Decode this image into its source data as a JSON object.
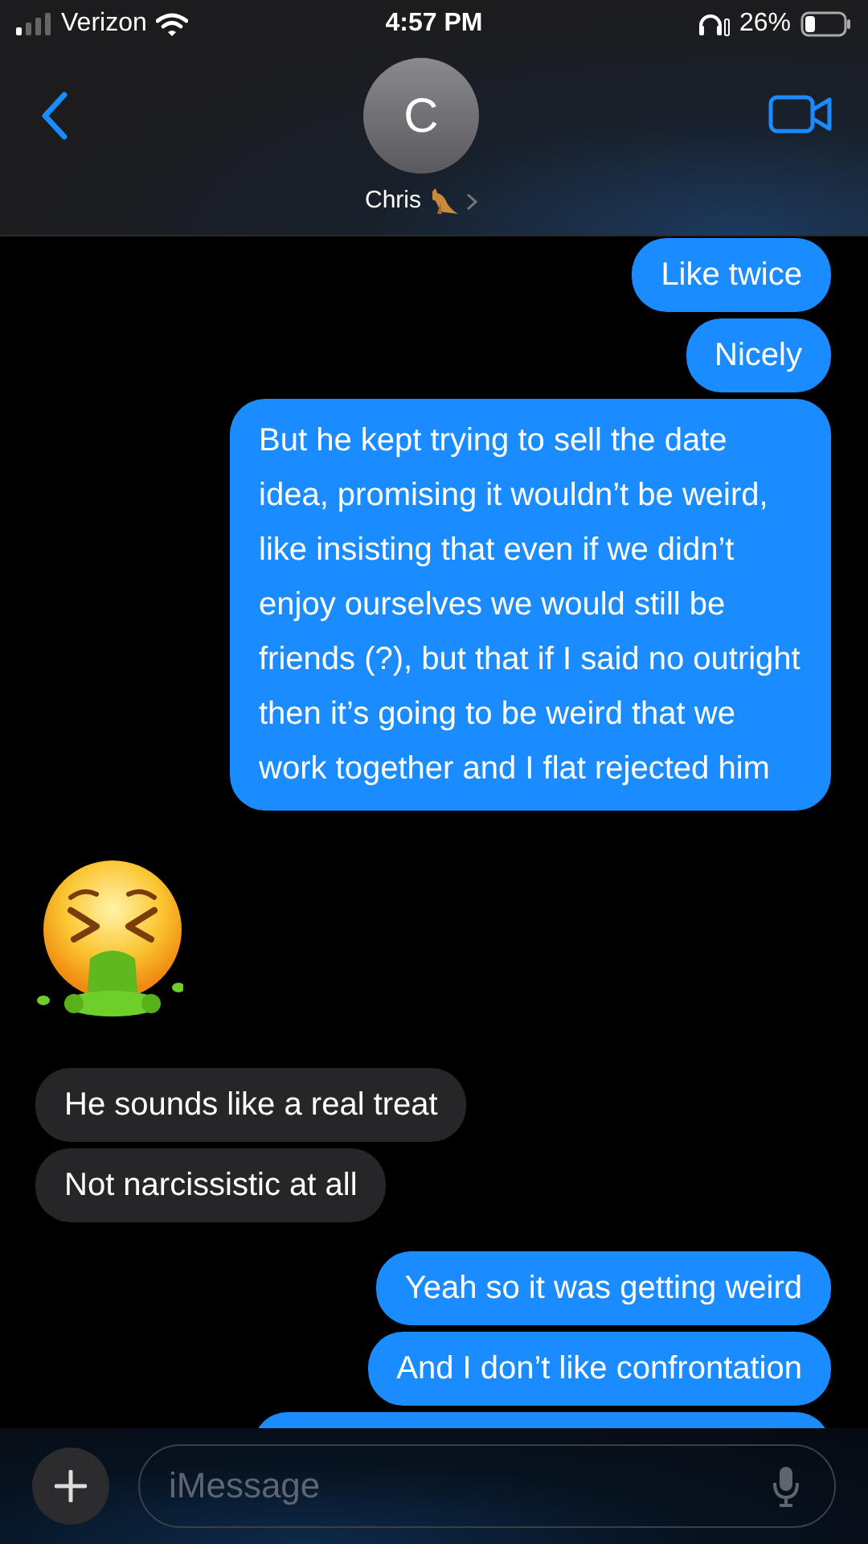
{
  "status_bar": {
    "carrier": "Verizon",
    "time": "4:57 PM",
    "battery": "26%"
  },
  "header": {
    "avatar_initial": "C",
    "contact_name": "Chris"
  },
  "messages": [
    {
      "kind": "text",
      "outgoing": true,
      "text": "Like twice"
    },
    {
      "kind": "text",
      "outgoing": true,
      "text": "Nicely"
    },
    {
      "kind": "text",
      "outgoing": true,
      "text": "But he kept trying to sell the date idea, promising it wouldn’t be weird, like insisting that even if we didn’t enjoy ourselves we would still be friends (?), but that if I said no outright then it’s going to be weird that we work together and I flat rejected him"
    },
    {
      "kind": "emoji",
      "outgoing": false
    },
    {
      "kind": "text",
      "outgoing": false,
      "text": "He sounds like a real treat"
    },
    {
      "kind": "text",
      "outgoing": false,
      "text": "Not narcissistic at all"
    },
    {
      "kind": "text",
      "outgoing": true,
      "text": "Yeah so it was getting weird"
    },
    {
      "kind": "text",
      "outgoing": true,
      "text": "And I don’t like confrontation"
    }
  ],
  "composer": {
    "placeholder": "iMessage"
  }
}
